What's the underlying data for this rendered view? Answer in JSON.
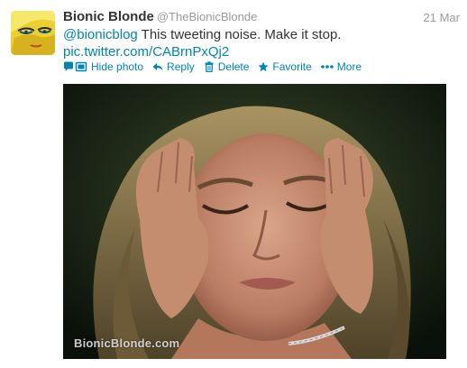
{
  "tweet": {
    "author": {
      "fullname": "Bionic Blonde",
      "username": "@TheBionicBlonde"
    },
    "timestamp": "21 Mar",
    "text": {
      "mention": "@bionicblog",
      "body": " This tweeting noise. Make it stop.",
      "link": "pic.twitter.com/CABrnPxQj2"
    },
    "actions": {
      "hide_photo": "Hide photo",
      "reply": "Reply",
      "delete": "Delete",
      "favorite": "Favorite",
      "more": "More"
    },
    "photo": {
      "watermark": "BionicBlonde.com"
    }
  },
  "colors": {
    "link": "#0084b4",
    "text": "#333333",
    "muted": "#999999"
  },
  "icons": [
    "conversation-icon",
    "photo-icon",
    "reply-icon",
    "trash-icon",
    "star-icon",
    "more-dots-icon"
  ]
}
